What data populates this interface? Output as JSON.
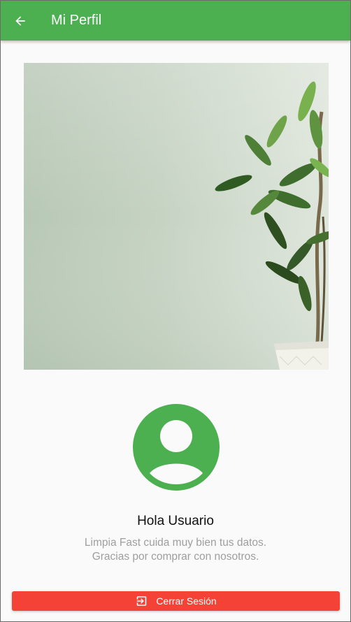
{
  "appbar": {
    "title": "Mi Perfil",
    "background_color": "#4caf50",
    "back_icon": "arrow-back-icon"
  },
  "hero_image": {
    "description_icon": "plant-photo"
  },
  "profile": {
    "avatar_icon": "account-circle-icon",
    "avatar_color": "#4caf50",
    "greeting": "Hola Usuario",
    "subtitle_line1": "Limpia Fast cuida muy bien tus datos.",
    "subtitle_line2": "Gracias por comprar con nosotros."
  },
  "logout_button": {
    "label": "Cerrar Sesión",
    "icon": "exit-to-app-icon",
    "color": "#f44336"
  }
}
